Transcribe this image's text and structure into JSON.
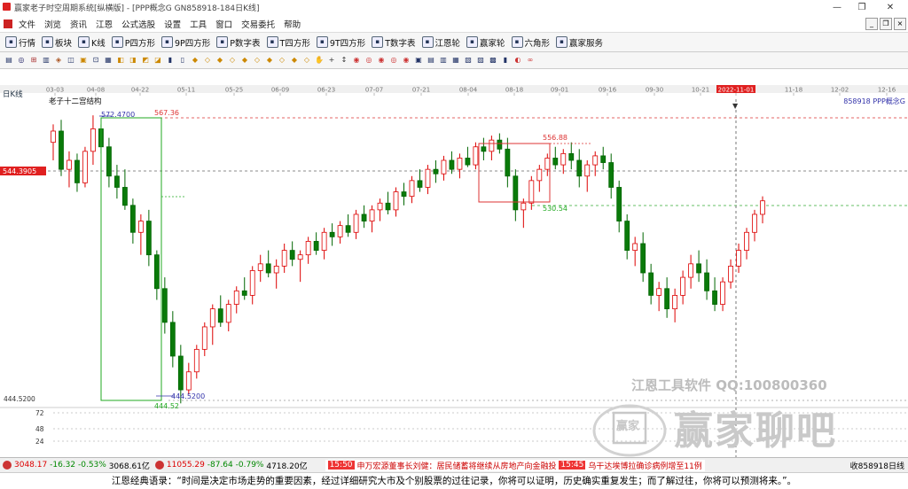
{
  "window": {
    "title": "赢家老子时空周期系统[纵横版] - [PPP概念G  GN858918-184日K线]",
    "min": "—",
    "max": "❐",
    "close": "✕"
  },
  "menu": [
    "文件",
    "浏览",
    "资讯",
    "江恩",
    "公式选股",
    "设置",
    "工具",
    "窗口",
    "交易委托",
    "帮助"
  ],
  "toolbar1": [
    {
      "icon": "grid-icon",
      "label": "行情"
    },
    {
      "icon": "blocks-icon",
      "label": "板块"
    },
    {
      "icon": "candle-icon",
      "label": "K线"
    },
    {
      "icon": "p-icon",
      "label": "P四方形"
    },
    {
      "icon": "9p-icon",
      "label": "9P四方形"
    },
    {
      "icon": "p-icon",
      "label": "P数字表"
    },
    {
      "icon": "t-icon",
      "label": "T四方形"
    },
    {
      "icon": "9t-icon",
      "label": "9T四方形"
    },
    {
      "icon": "tn-icon",
      "label": "T数字表"
    },
    {
      "icon": "wheel-icon",
      "label": "江恩轮"
    },
    {
      "icon": "wheel-icon",
      "label": "赢家轮"
    },
    {
      "icon": "hexagon-icon",
      "label": "六角形"
    },
    {
      "icon": "service-icon",
      "label": "赢家服务"
    }
  ],
  "chart": {
    "period_label": "日K线",
    "structure_label": "老子十二宫结构",
    "code_label": "858918 PPP概念G",
    "current_price_tag": "544.3905",
    "low_axis_label": "444.5200",
    "dates": [
      "03-03",
      "04-08",
      "04-22",
      "05-11",
      "05-25",
      "06-09",
      "06-23",
      "07-07",
      "07-21",
      "08-04",
      "08-18",
      "09-01",
      "09-16",
      "09-30",
      "10-21",
      "2022-11-01",
      "11-18",
      "12-02",
      "12-16"
    ],
    "annotations": {
      "high_left": "572.4700",
      "high_red": "567.36",
      "low_left": "444.5200",
      "low_bottom": "444.52",
      "box_high": "556.88",
      "box_low": "530.54"
    },
    "volume_axis": [
      "72",
      "48",
      "24"
    ]
  },
  "chart_data": {
    "type": "candlestick",
    "title": "PPP概念G",
    "price_high": 572.47,
    "price_low": 444.52,
    "current": 544.3905,
    "candles": [
      [
        560,
        568,
        552,
        565
      ],
      [
        565,
        570,
        545,
        548
      ],
      [
        548,
        556,
        540,
        552
      ],
      [
        552,
        555,
        538,
        542
      ],
      [
        542,
        558,
        540,
        556
      ],
      [
        556,
        572,
        550,
        566
      ],
      [
        566,
        568,
        555,
        558
      ],
      [
        558,
        562,
        540,
        545
      ],
      [
        545,
        550,
        535,
        540
      ],
      [
        540,
        548,
        530,
        532
      ],
      [
        532,
        535,
        515,
        520
      ],
      [
        520,
        528,
        510,
        525
      ],
      [
        525,
        530,
        505,
        510
      ],
      [
        510,
        512,
        490,
        495
      ],
      [
        495,
        500,
        475,
        480
      ],
      [
        480,
        485,
        460,
        465
      ],
      [
        465,
        470,
        444,
        450
      ],
      [
        450,
        462,
        448,
        458
      ],
      [
        458,
        470,
        455,
        468
      ],
      [
        468,
        480,
        465,
        478
      ],
      [
        478,
        488,
        470,
        486
      ],
      [
        486,
        492,
        478,
        480
      ],
      [
        480,
        490,
        476,
        488
      ],
      [
        488,
        496,
        484,
        494
      ],
      [
        494,
        500,
        490,
        492
      ],
      [
        492,
        505,
        488,
        503
      ],
      [
        503,
        510,
        498,
        506
      ],
      [
        506,
        512,
        500,
        502
      ],
      [
        502,
        508,
        495,
        505
      ],
      [
        505,
        515,
        502,
        512
      ],
      [
        512,
        516,
        505,
        508
      ],
      [
        508,
        512,
        498,
        510
      ],
      [
        510,
        518,
        506,
        516
      ],
      [
        516,
        520,
        510,
        512
      ],
      [
        512,
        522,
        508,
        520
      ],
      [
        520,
        524,
        514,
        518
      ],
      [
        518,
        525,
        515,
        523
      ],
      [
        523,
        528,
        518,
        520
      ],
      [
        520,
        530,
        517,
        528
      ],
      [
        528,
        532,
        522,
        525
      ],
      [
        525,
        532,
        520,
        530
      ],
      [
        530,
        535,
        525,
        533
      ],
      [
        533,
        538,
        528,
        530
      ],
      [
        530,
        540,
        527,
        538
      ],
      [
        538,
        542,
        532,
        536
      ],
      [
        536,
        545,
        533,
        543
      ],
      [
        543,
        548,
        538,
        540
      ],
      [
        540,
        550,
        537,
        548
      ],
      [
        548,
        552,
        542,
        546
      ],
      [
        546,
        554,
        543,
        552
      ],
      [
        552,
        556,
        546,
        548
      ],
      [
        548,
        555,
        544,
        553
      ],
      [
        553,
        558,
        549,
        550
      ],
      [
        550,
        560,
        548,
        558
      ],
      [
        558,
        562,
        552,
        556
      ],
      [
        556,
        563,
        552,
        561
      ],
      [
        561,
        564,
        555,
        557
      ],
      [
        557,
        562,
        540,
        545
      ],
      [
        545,
        548,
        525,
        530
      ],
      [
        530,
        535,
        522,
        533
      ],
      [
        533,
        545,
        530,
        543
      ],
      [
        543,
        550,
        538,
        548
      ],
      [
        548,
        555,
        545,
        553
      ],
      [
        553,
        558,
        548,
        550
      ],
      [
        550,
        557,
        546,
        555
      ],
      [
        555,
        560,
        548,
        552
      ],
      [
        552,
        557,
        540,
        545
      ],
      [
        545,
        552,
        538,
        550
      ],
      [
        550,
        556,
        545,
        554
      ],
      [
        554,
        558,
        548,
        551
      ],
      [
        551,
        555,
        535,
        540
      ],
      [
        540,
        543,
        520,
        525
      ],
      [
        525,
        528,
        508,
        512
      ],
      [
        512,
        518,
        505,
        515
      ],
      [
        515,
        520,
        498,
        502
      ],
      [
        502,
        506,
        488,
        492
      ],
      [
        492,
        498,
        485,
        495
      ],
      [
        495,
        500,
        482,
        486
      ],
      [
        486,
        495,
        480,
        492
      ],
      [
        492,
        503,
        488,
        500
      ],
      [
        500,
        510,
        495,
        506
      ],
      [
        506,
        512,
        498,
        502
      ],
      [
        502,
        508,
        490,
        494
      ],
      [
        494,
        500,
        485,
        488
      ],
      [
        488,
        500,
        485,
        498
      ],
      [
        498,
        508,
        495,
        505
      ],
      [
        505,
        515,
        502,
        512
      ],
      [
        512,
        522,
        508,
        520
      ],
      [
        520,
        530,
        516,
        528
      ],
      [
        528,
        536,
        524,
        534
      ]
    ]
  },
  "status": {
    "sh_value": "3048.17",
    "sh_change": "-16.32",
    "sh_pct": "-0.53%",
    "sh_vol": "3068.61亿",
    "sz_value": "11055.29",
    "sz_change": "-87.64",
    "sz_pct": "-0.79%",
    "sz_vol": "4718.20亿",
    "news_time1": "15:50",
    "news1": "申万宏源董事长刘健：居民储蓄将继续从房地产向金融投",
    "news_time2": "15:45",
    "news2": "乌干达埃博拉确诊病例增至11例",
    "right": "收858918日线"
  },
  "watermark": {
    "tool": "江恩工具软件  QQ:100800360",
    "brand": "赢家聊吧",
    "seal": "赢家"
  },
  "quote": "江恩经典语录：“时间是决定市场走势的重要因素，经过详细研究大市及个别股票的过往记录，你将可以证明，历史确实重复发生；而了解过往，你将可以预测将来。”。"
}
